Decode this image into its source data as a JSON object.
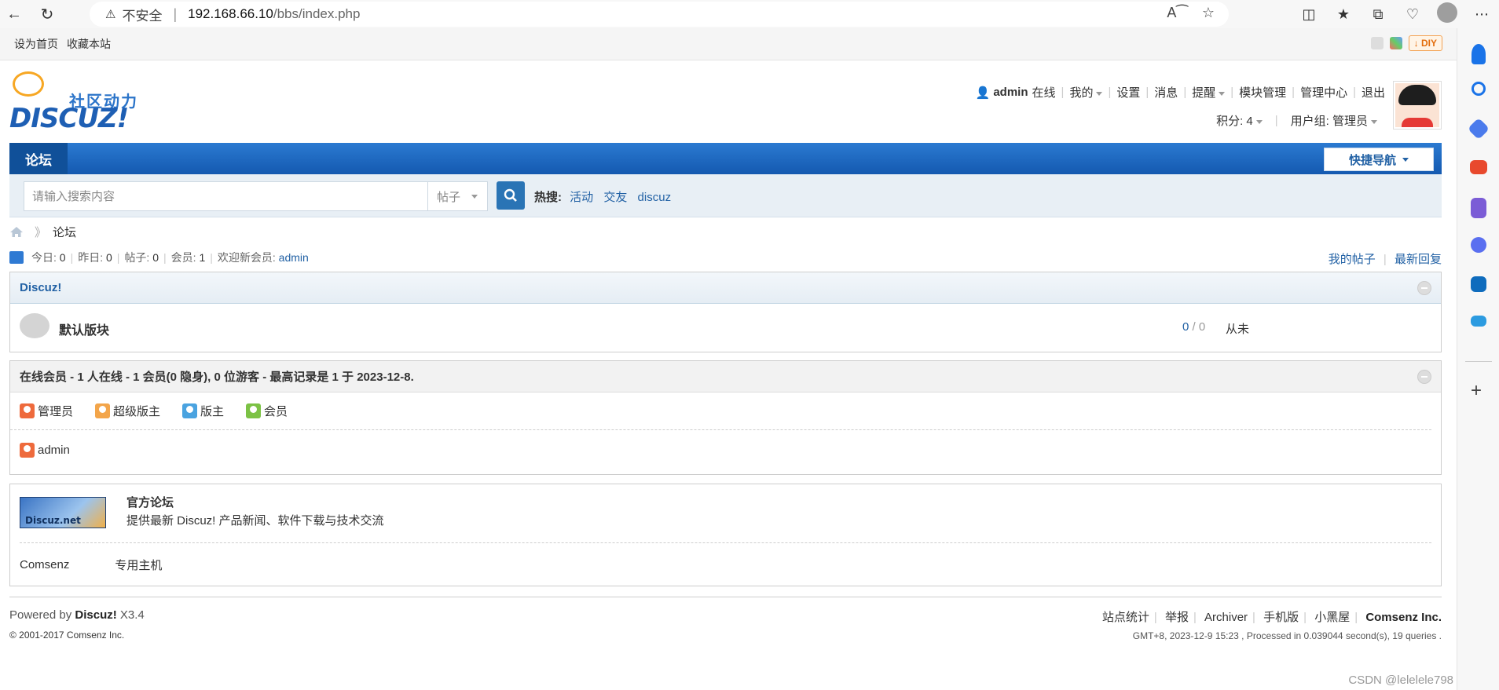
{
  "browser": {
    "insecure_label": "不安全",
    "url_host": "192.168.66.10",
    "url_path": "/bbs/index.php"
  },
  "topbar": {
    "set_home": "设为首页",
    "bookmark": "收藏本站",
    "diy_label": "DIY"
  },
  "logo": {
    "cn": "社区动力",
    "en": "DISCUZ!"
  },
  "user": {
    "name": "admin",
    "online": "在线",
    "links": [
      "我的",
      "设置",
      "消息",
      "提醒",
      "模块管理",
      "管理中心",
      "退出"
    ],
    "credits_label": "积分: 4",
    "group_label": "用户组: 管理员"
  },
  "nav": {
    "forum_tab": "论坛",
    "quick_nav": "快捷导航"
  },
  "search": {
    "placeholder": "请输入搜索内容",
    "type": "帖子",
    "hot_label": "热搜:",
    "hot_terms": [
      "活动",
      "交友",
      "discuz"
    ]
  },
  "breadcrumb": {
    "current": "论坛"
  },
  "stats": {
    "today_label": "今日:",
    "today": "0",
    "yesterday_label": "昨日:",
    "yesterday": "0",
    "posts_label": "帖子:",
    "posts": "0",
    "members_label": "会员:",
    "members": "1",
    "welcome_label": "欢迎新会员:",
    "newest": "admin",
    "my_posts": "我的帖子",
    "latest_replies": "最新回复"
  },
  "category": {
    "title": "Discuz!",
    "forum_name": "默认版块",
    "threads": "0",
    "posts": "0",
    "last_post": "从未"
  },
  "online": {
    "title": "在线会员 - 1 人在线 - 1 会员(0 隐身), 0 位游客 - 最高记录是 1 于 2023-12-8.",
    "roles": [
      {
        "label": "管理员",
        "color": "#ee6a3c"
      },
      {
        "label": "超级版主",
        "color": "#f3a54a"
      },
      {
        "label": "版主",
        "color": "#4aa3e0"
      },
      {
        "label": "会员",
        "color": "#7cc245"
      }
    ],
    "users": [
      "admin"
    ]
  },
  "links": {
    "banner_text": "Discuz.net",
    "site_name": "官方论坛",
    "site_desc": "提供最新 Discuz! 产品新闻、软件下载与技术交流",
    "text_links": [
      "Comsenz",
      "专用主机"
    ]
  },
  "footer": {
    "powered_prefix": "Powered by",
    "product": "Discuz!",
    "version": "X3.4",
    "copyright": "© 2001-2017",
    "copyright_org": "Comsenz Inc.",
    "links": [
      "站点统计",
      "举报",
      "Archiver",
      "手机版",
      "小黑屋"
    ],
    "company": "Comsenz Inc.",
    "meta": "GMT+8, 2023-12-9 15:23 , Processed in 0.039044 second(s), 19 queries ."
  },
  "watermark": "CSDN @lelelele798"
}
